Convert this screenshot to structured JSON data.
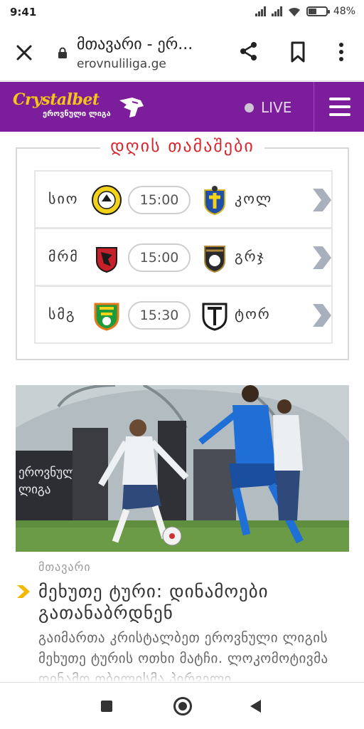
{
  "status_bar": {
    "time": "9:41",
    "battery_percent": "48%",
    "battery_level": 0.48
  },
  "browser": {
    "page_title": "მთავარი - ერ...",
    "url": "erovnuliliga.ge"
  },
  "site_header": {
    "brand": "Crystalbet",
    "brand_sub": "ეროვნული ლიგა",
    "live_label": "LIVE",
    "colors": {
      "bar": "#7c1e9b",
      "brand": "#f5c518"
    }
  },
  "matches": {
    "heading": "დღის თამაშები",
    "heading_color": "#d9262f",
    "items": [
      {
        "home": "სიო",
        "time": "15:00",
        "away": "კოლ",
        "home_icon": "sioni-crest-icon",
        "away_icon": "kolkheti-crest-icon"
      },
      {
        "home": "მრმ",
        "time": "15:00",
        "away": "გრჯ",
        "home_icon": "merani-crest-icon",
        "away_icon": "gareji-crest-icon"
      },
      {
        "home": "სმგ",
        "time": "15:30",
        "away": "ტორ",
        "home_icon": "samgurali-crest-icon",
        "away_icon": "torpedo-crest-icon"
      }
    ]
  },
  "news": {
    "banner_text": "ეროვნული ლიგა",
    "category": "მთავარი",
    "headline": "მეხუთე ტური: დინამოები გათანაბრდნენ",
    "excerpt": "გაიმართა კრისტალბეთ ეროვნული ლიგის მეხუთე ტურის ოთხი მატჩი. ლოკომოტივმა დინამო თბილისმა პირველი",
    "accent_color": "#f5b800"
  }
}
